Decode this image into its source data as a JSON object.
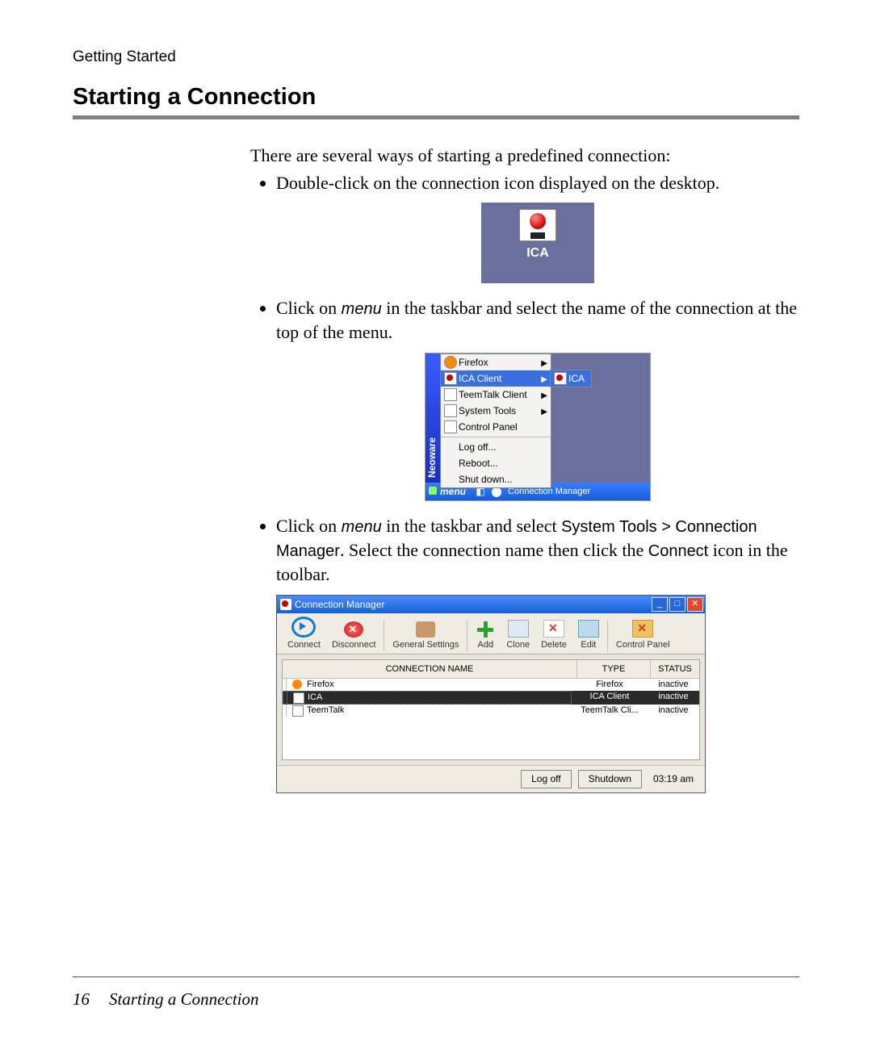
{
  "header": {
    "section": "Getting Started",
    "title": "Starting a Connection"
  },
  "intro": "There are several ways of starting a predefined connection:",
  "bullets": {
    "b1": "Double-click on the connection icon displayed on the desktop.",
    "b2a": "Click on ",
    "b2_menu": "menu",
    "b2b": " in the taskbar and select the name of the connection at the top of the menu.",
    "b3a": "Click on ",
    "b3_menu": "menu",
    "b3b": " in the taskbar and select ",
    "b3_path": "System Tools > Connection Manager",
    "b3c": ". Select the connection name then click the ",
    "b3_connect": "Connect",
    "b3d": " icon in the toolbar."
  },
  "desktop_icon": {
    "label": "ICA"
  },
  "menu_shot": {
    "sidebar": "Neoware",
    "items": [
      {
        "label": "Firefox",
        "class": "ff",
        "sub": true
      },
      {
        "label": "ICA Client",
        "class": "red",
        "sub": true,
        "selected": true
      },
      {
        "label": "TeemTalk Client",
        "class": "",
        "sub": true
      },
      {
        "label": "System Tools",
        "class": "",
        "sub": true
      },
      {
        "label": "Control Panel",
        "class": ""
      }
    ],
    "items_bottom": [
      {
        "label": "Log off..."
      },
      {
        "label": "Reboot..."
      },
      {
        "label": "Shut down..."
      }
    ],
    "submenu_item": "ICA",
    "taskbar": {
      "menu": "menu",
      "cm": "Connection Manager"
    }
  },
  "cm": {
    "title": "Connection Manager",
    "toolbar": [
      {
        "label": "Connect",
        "icon": "play"
      },
      {
        "label": "Disconnect",
        "icon": "disc"
      },
      {
        "label": "General Settings",
        "icon": "gear"
      },
      {
        "label": "Add",
        "icon": "add"
      },
      {
        "label": "Clone",
        "icon": "clone"
      },
      {
        "label": "Delete",
        "icon": "del"
      },
      {
        "label": "Edit",
        "icon": "edit"
      },
      {
        "label": "Control Panel",
        "icon": "cp"
      }
    ],
    "cols": {
      "name": "CONNECTION NAME",
      "type": "TYPE",
      "status": "STATUS"
    },
    "rows": [
      {
        "name": "Firefox",
        "type": "Firefox",
        "status": "inactive",
        "icon": "ff"
      },
      {
        "name": "ICA",
        "type": "ICA Client",
        "status": "inactive",
        "icon": "red",
        "selected": true
      },
      {
        "name": "TeemTalk",
        "type": "TeemTalk Cli...",
        "status": "inactive",
        "icon": ""
      }
    ],
    "footer": {
      "logoff": "Log off",
      "shutdown": "Shutdown",
      "time": "03:19 am"
    }
  },
  "footer": {
    "page": "16",
    "title": "Starting a Connection"
  }
}
